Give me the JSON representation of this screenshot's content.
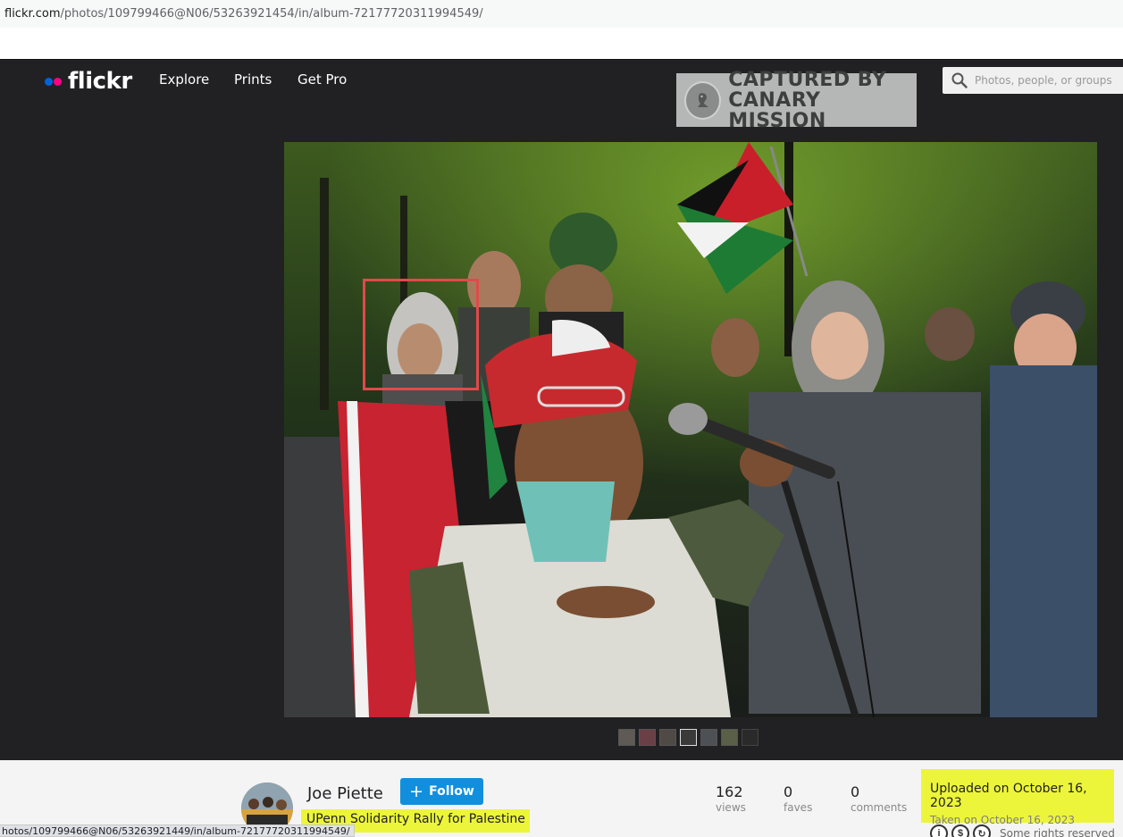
{
  "browser": {
    "url_domain": "flickr.com",
    "url_path": "/photos/109799466@N06/53263921454/in/album-72177720311994549/",
    "status_url": "hotos/109799466@N06/53263921449/in/album-72177720311994549/"
  },
  "header": {
    "logo_text": "flickr",
    "nav": [
      "Explore",
      "Prints",
      "Get Pro"
    ],
    "search_placeholder": "Photos, people, or groups",
    "icons": {
      "search": "search-icon"
    }
  },
  "watermark": {
    "line1": "CAPTURED BY",
    "line2": "CANARY MISSION"
  },
  "photo": {
    "highlight_color": "#e04a4a"
  },
  "thumbnails": {
    "count": 7
  },
  "info": {
    "author": "Joe Piette",
    "follow_label": "Follow",
    "album_title": "UPenn Solidarity Rally for Palestine",
    "stats": [
      {
        "value": "162",
        "label": "views"
      },
      {
        "value": "0",
        "label": "faves"
      },
      {
        "value": "0",
        "label": "comments"
      }
    ],
    "uploaded": "Uploaded on October 16, 2023",
    "taken": "Taken on October 16, 2023",
    "license_text": "Some rights reserved",
    "highlight_color": "#ecf53a",
    "accent_color": "#128fdc"
  }
}
